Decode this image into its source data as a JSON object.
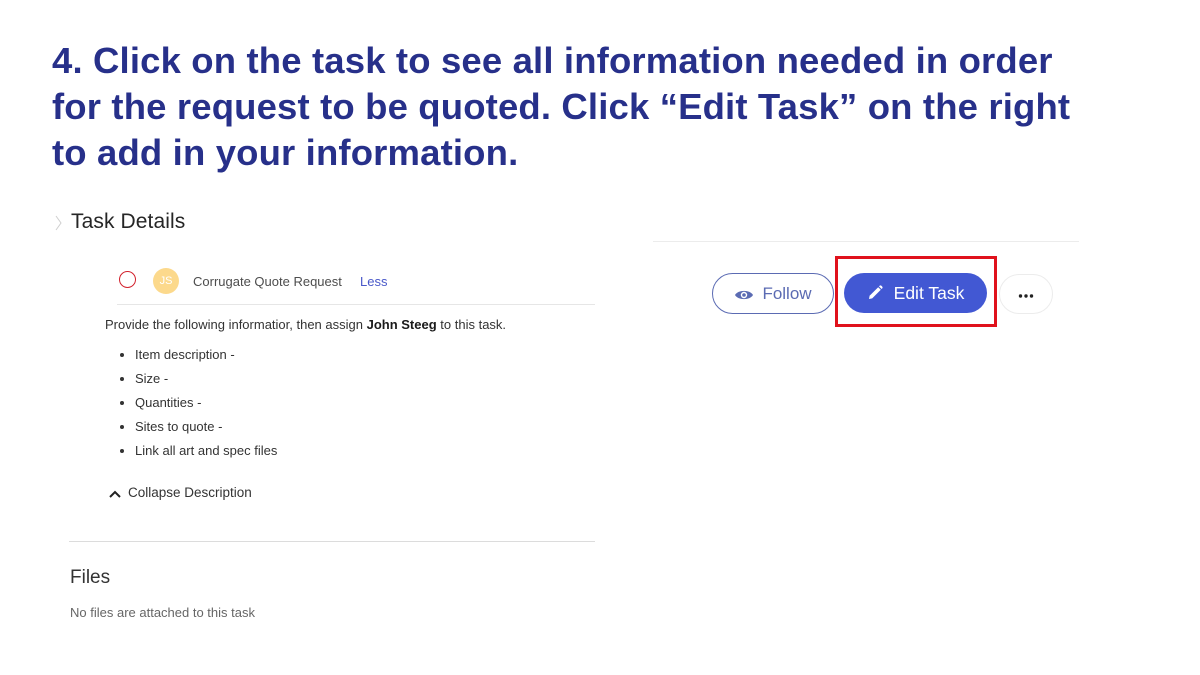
{
  "instruction": {
    "lines": [
      "4. Click on the task to see all information needed in order",
      "for the request to be quoted. Click “Edit Task” on the right",
      "to add in your information."
    ]
  },
  "task_details": {
    "title": "Task Details",
    "task": {
      "assignee_initials": "JS",
      "name": "Corrugate Quote Request",
      "toggle_label": "Less"
    },
    "description": {
      "prefix": "Provide the following informatior, then assign ",
      "assignee_name": "John Steeg",
      "suffix": " to this task.",
      "items": [
        "Item description -",
        "Size -",
        "Quantities -",
        "Sites to quote -",
        "Link all art and spec files"
      ],
      "collapse_label": "Collapse Description"
    },
    "files": {
      "title": "Files",
      "empty_text": "No files are attached to this task"
    }
  },
  "actions": {
    "follow_label": "Follow",
    "edit_label": "Edit Task",
    "more_label": "···"
  },
  "colors": {
    "instruction_text": "#27308a",
    "accent_blue": "#4258d3",
    "follow_outline": "#5b6bb3",
    "highlight_red": "#e0121c",
    "avatar_yellow": "#fcd98c",
    "complete_circle_red": "#d2222d"
  },
  "icons": {
    "follow": "eye-icon",
    "edit": "pencil-icon",
    "more": "ellipsis-icon",
    "collapse": "chevron-up-icon",
    "complete": "circle-icon"
  }
}
